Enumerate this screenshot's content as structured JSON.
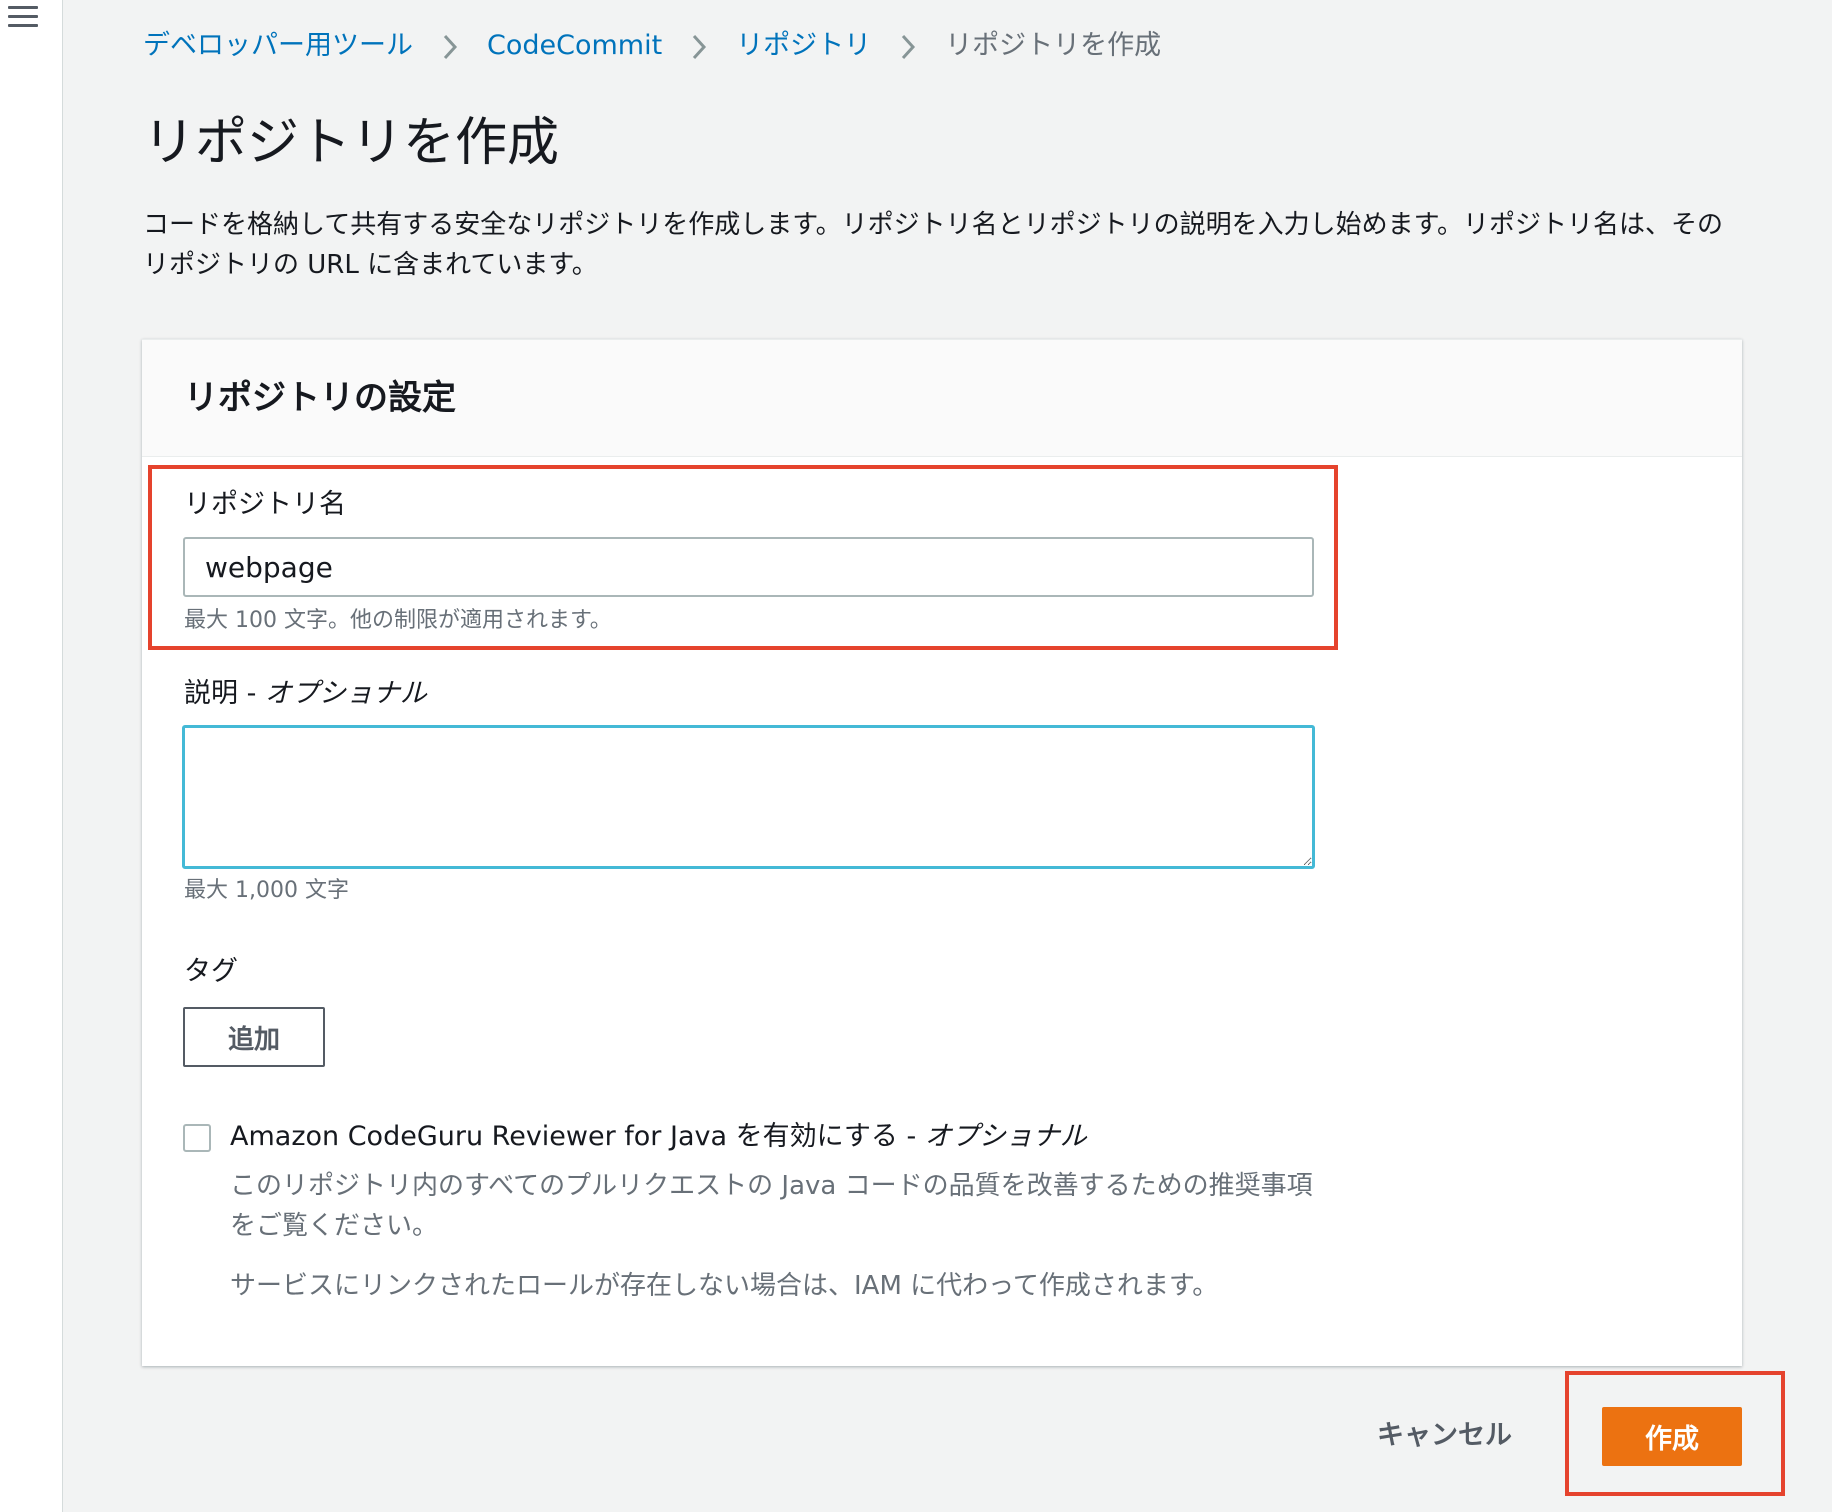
{
  "breadcrumb": {
    "items": [
      "デベロッパー用ツール",
      "CodeCommit",
      "リポジトリ"
    ],
    "current": "リポジトリを作成"
  },
  "page": {
    "title": "リポジトリを作成",
    "description": "コードを格納して共有する安全なリポジトリを作成します。リポジトリ名とリポジトリの説明を入力し始めます。リポジトリ名は、そのリポジトリの URL に含まれています。"
  },
  "panel": {
    "title": "リポジトリの設定",
    "name_field": {
      "label": "リポジトリ名",
      "value": "webpage",
      "hint": "最大 100 文字。他の制限が適用されます。"
    },
    "description_field": {
      "label": "説明",
      "optional": "オプショナル",
      "value": "",
      "hint": "最大 1,000 文字"
    },
    "tags": {
      "label": "タグ",
      "add_label": "追加"
    },
    "codeguru": {
      "label": "Amazon CodeGuru Reviewer for Java を有効にする",
      "optional": "オプショナル",
      "checked": false,
      "description": "このリポジトリ内のすべてのプルリクエストの Java コードの品質を改善するための推奨事項をご覧ください。",
      "note": "サービスにリンクされたロールが存在しない場合は、IAM に代わって作成されます。"
    }
  },
  "actions": {
    "cancel_label": "キャンセル",
    "create_label": "作成"
  },
  "colors": {
    "link": "#0073bb",
    "primary": "#ec7211",
    "highlight": "#e5432d",
    "focus": "#44b9d6",
    "background": "#f2f3f3"
  }
}
